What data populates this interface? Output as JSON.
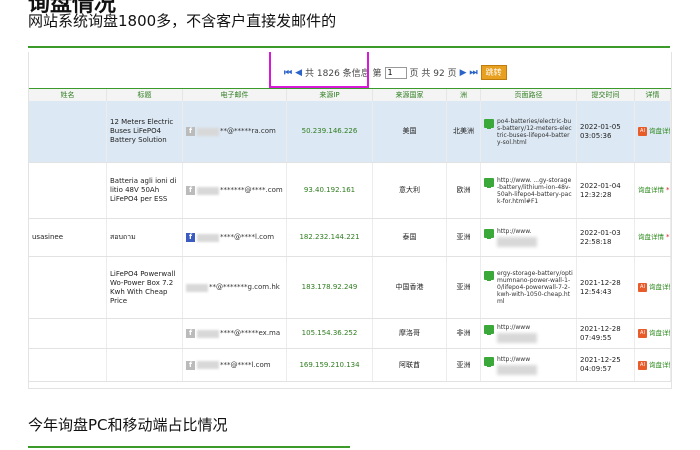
{
  "headline": "网站系统询盘1800多，不含客户直接发邮件的",
  "pager": {
    "first_icon": "⏮",
    "prev_icon": "◀",
    "text_prefix": "共 1826 条信息 第",
    "current_page": "1",
    "text_suffix": "页 共 92 页",
    "next_icon": "▶",
    "last_icon": "⏭",
    "go_label": "跳转"
  },
  "table": {
    "columns": [
      "姓名",
      "标题",
      "电子邮件",
      "来源IP",
      "来源国家",
      "洲",
      "页面路径",
      "提交时间",
      "详情"
    ],
    "rows": [
      {
        "name": "",
        "title": "12 Meters Electric Buses LiFePO4 Battery Solution",
        "email": "**@*****ra.com",
        "email_icon": "f",
        "ip": "50.239.146.226",
        "country": "美国",
        "continent": "北美洲",
        "url": "po4-batteries/electric-bus-battery/12-meters-electric-buses-lifepo4-battery-sol.html",
        "time": "2022-01-05 03:05:36",
        "has_ai": true,
        "detail": "询盘详情"
      },
      {
        "name": "",
        "title": "Batteria agli ioni di litio 48V 50Ah LiFePO4 per ESS",
        "email": "*******@****.com",
        "email_icon": "f",
        "ip": "93.40.192.161",
        "country": "意大利",
        "continent": "欧洲",
        "url": "http://www. ...gy-storage-battery/lithium-ion-48v-50ah-lifepo4-battery-pack-for.html#F1",
        "time": "2022-01-04 12:32:28",
        "has_ai": false,
        "detail": "询盘详情"
      },
      {
        "name": "usasinee",
        "title": "สอบถาม",
        "email": "****@****l.com",
        "email_icon": "f",
        "ip": "182.232.144.221",
        "country": "泰国",
        "continent": "亚洲",
        "url": "http://www.",
        "time": "2022-01-03 22:58:18",
        "has_ai": false,
        "detail": "询盘详情"
      },
      {
        "name": "",
        "title": "LiFePO4 Powerwall Wo-Power Box 7.2 Kwh With Cheap Price",
        "email": "**@*******g.com.hk",
        "email_icon": "",
        "ip": "183.178.92.249",
        "country": "中国香港",
        "continent": "亚洲",
        "url": "ergy-storage-battery/optimumnano-power-wall-1-0/lifepo4-powerwall-7-2-kwh-with-1050-cheap.html",
        "time": "2021-12-28 12:54:43",
        "has_ai": true,
        "detail": "询盘详情"
      },
      {
        "name": "",
        "title": "",
        "email": "****@*****ex.ma",
        "email_icon": "f",
        "ip": "105.154.36.252",
        "country": "摩洛哥",
        "continent": "非洲",
        "url": "http://www",
        "time": "2021-12-28 07:49:55",
        "has_ai": true,
        "detail": "询盘详情"
      },
      {
        "name": "",
        "title": "",
        "email": "***@****l.com",
        "email_icon": "f",
        "ip": "169.159.210.134",
        "country": "阿联酋",
        "continent": "亚洲",
        "url": "http://www",
        "time": "2021-12-25 04:09:57",
        "has_ai": true,
        "detail": "询盘详情"
      }
    ]
  },
  "subhead": "今年询盘PC和移动端占比情况",
  "colors": {
    "accent_green": "#3a9a2a",
    "highlight_magenta": "#d81ad8",
    "selected_row": "#dce8f3"
  }
}
